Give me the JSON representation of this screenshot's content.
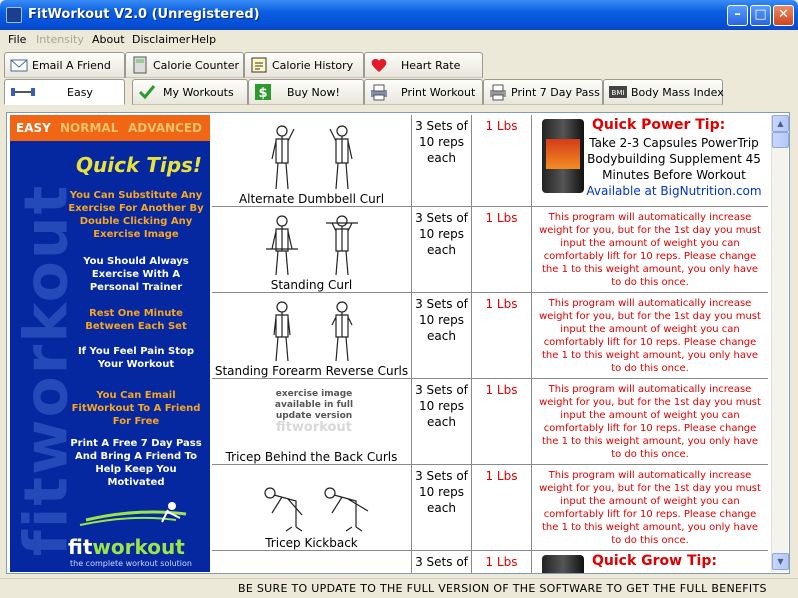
{
  "window": {
    "title": "FitWorkout V2.0 (Unregistered)",
    "minimize": "–",
    "maximize": "□",
    "close": "✕"
  },
  "menu": {
    "items": [
      "File",
      "Intensity",
      "About",
      "Disclaimer",
      "Help"
    ]
  },
  "tabs": {
    "row1": [
      {
        "label": "Email A Friend",
        "icon": "envelope-icon"
      },
      {
        "label": "Calorie Counter",
        "icon": "calculator-icon"
      },
      {
        "label": "Calorie History",
        "icon": "history-icon"
      },
      {
        "label": "Heart Rate",
        "icon": "heart-icon"
      }
    ],
    "row2": [
      {
        "label": "Easy",
        "icon": "dumbbell-icon"
      },
      {
        "label": "My Workouts",
        "icon": "checkmark-icon"
      },
      {
        "label": "Buy Now!",
        "icon": "dollar-icon"
      },
      {
        "label": "Print Workout",
        "icon": "printer-icon"
      },
      {
        "label": "Print 7 Day Pass",
        "icon": "printer-pass-icon"
      },
      {
        "label": "Body Mass Index",
        "icon": "bmi-icon"
      }
    ]
  },
  "sidebar": {
    "levels": [
      "EASY",
      "NORMAL",
      "ADVANCED"
    ],
    "watermark": "fitworkout",
    "tips_title": "Quick Tips!",
    "tips": [
      {
        "text": "You Can Substitute Any Exercise For Another By Double Clicking Any Exercise Image",
        "color": "#f5a623"
      },
      {
        "text": "You Should Always Exercise With A Personal Trainer",
        "color": "#ffffff"
      },
      {
        "text": "Rest One Minute Between Each Set",
        "color": "#f5a623"
      },
      {
        "text": "If You Feel Pain Stop Your Workout",
        "color": "#ffffff"
      },
      {
        "text": "You Can Email FitWorkout To A Friend For Free",
        "color": "#f5a623"
      },
      {
        "text": "Print A Free 7 Day Pass And Bring A Friend To Help Keep You Motivated",
        "color": "#ffffff"
      }
    ],
    "logo_fit": "fit",
    "logo_workout": "workout",
    "logo_tagline": "the complete workout solution"
  },
  "exercises": [
    {
      "name": "Alternate Dumbbell Curl",
      "sets": "3 Sets of 10 reps each",
      "weight": "1 Lbs",
      "image": "figure"
    },
    {
      "name": "Standing Curl",
      "sets": "3 Sets of 10 reps each",
      "weight": "1 Lbs",
      "image": "figure"
    },
    {
      "name": "Standing Forearm Reverse Curls",
      "sets": "3 Sets of 10 reps each",
      "weight": "1 Lbs",
      "image": "figure"
    },
    {
      "name": "Tricep Behind the Back Curls",
      "sets": "3 Sets of 10 reps each",
      "weight": "1 Lbs",
      "image": "placeholder"
    },
    {
      "name": "Tricep Kickback",
      "sets": "3 Sets of 10 reps each",
      "weight": "1 Lbs",
      "image": "figure"
    },
    {
      "name": "",
      "sets": "3 Sets of",
      "weight": "1 Lbs",
      "image": "none"
    }
  ],
  "weight_note": "This program will automatically increase weight for you, but for the 1st day you must input the amount of weight you can comfortably lift for 10 reps. Please change the 1 to this weight amount, you only have to do this once.",
  "placeholder_text": "exercise image available in full update version",
  "placeholder_watermark": "fitworkout",
  "promo1": {
    "title": "Quick Power Tip:",
    "body": "Take 2-3 Capsules PowerTrip Bodybuilding Supplement 45 Minutes Before Workout",
    "link": "Available at BigNutrition.com"
  },
  "promo2": {
    "title": "Quick Grow Tip:"
  },
  "status": {
    "message": "BE SURE TO UPDATE TO THE FULL VERSION OF THE SOFTWARE TO GET THE FULL BENEFITS"
  },
  "colors": {
    "sidebar_bg": "#05279f",
    "level_bar": "#f06614",
    "level_easy": "#ffffff",
    "level_other": "#f8c16a",
    "tips_title": "#e8e23a",
    "red_text": "#e00000",
    "link": "#0033cc"
  }
}
